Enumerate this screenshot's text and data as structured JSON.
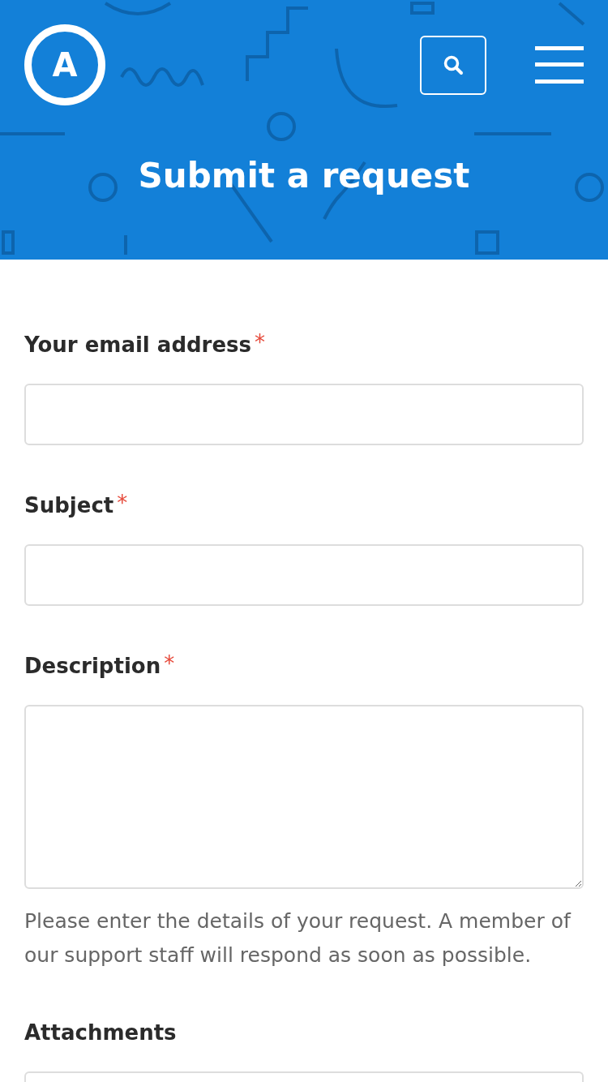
{
  "header": {
    "logo": "A",
    "title": "Submit a request"
  },
  "fields": [
    {
      "kind": "input",
      "label": "Your email address",
      "required": true
    },
    {
      "kind": "input",
      "label": "Subject",
      "required": true
    },
    {
      "kind": "textarea",
      "label": "Description",
      "required": true,
      "hint": "Please enter the details of your request. A member of our support staff will respond as soon as possible."
    },
    {
      "kind": "dropzone",
      "label": "Attachments",
      "required": false
    }
  ],
  "required_mark": "*"
}
